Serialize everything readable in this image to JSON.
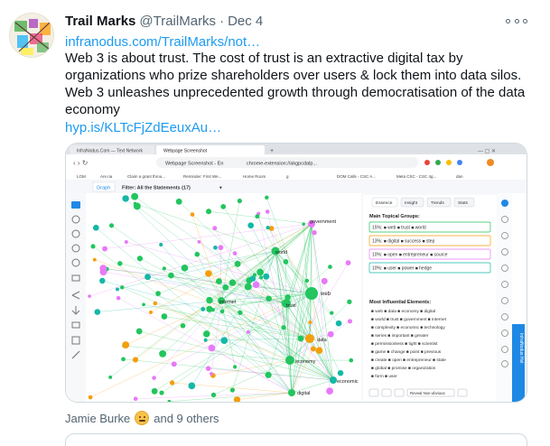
{
  "tweet": {
    "author_name": "Trail Marks",
    "handle": "@TrailMarks",
    "separator": "·",
    "date": "Dec 4",
    "link1": "infranodus.com/TrailMarks/not…",
    "text": "Web 3 is about trust. The cost of trust is an extractive digital tax by organizations who prize shareholders over users & lock them into data silos. Web 3 unleashes unprecedented growth through democratisation  of the data economy",
    "link2": "hyp.is/KLTcFjZdEeuxAu…",
    "likers_name": "Jamie Burke",
    "likers_rest": "and 9 others",
    "icons": {
      "more": "more-icon",
      "avatar": "avatar-image",
      "liker_emoji": "thinking-emoji-icon"
    },
    "colors": {
      "link": "#1d9bf0",
      "secondary": "#536471"
    }
  },
  "screenshot": {
    "tabs": [
      "InfraNodus.Com — Text Network",
      "Webpage Screenshot"
    ],
    "new_tab": "+",
    "address": "Webpage Screenshot - En",
    "address_url": "chrome-extension://akgpcdalp...",
    "bookmarks": [
      "LOM",
      "Are.na",
      "Claim a grant throu...",
      "Reminder: First We...",
      "Home Room",
      "g",
      "DOM Calls - CSC A...",
      "Meta CSC - CSC 4g...",
      "dan"
    ],
    "app_tab": "Graph",
    "filter_label": "Filter: All the Statements (17)",
    "filter_caret": "▾",
    "panel_tabs": [
      "Essence",
      "Insight",
      "Trends",
      "Stats"
    ],
    "main_groups_title": "Main Topical Groups:",
    "groups": [
      {
        "pct": "15%:",
        "terms": [
          "web",
          "trust",
          "world"
        ]
      },
      {
        "pct": "13%:",
        "terms": [
          "digital",
          "success",
          "step"
        ]
      },
      {
        "pct": "10%:",
        "terms": [
          "open",
          "entrepreneur",
          "source"
        ]
      },
      {
        "pct": "10%:",
        "terms": [
          "user",
          "power",
          "hedge"
        ]
      }
    ],
    "influential_title": "Most Influential Elements:",
    "influential_lines": [
      [
        "web",
        "data",
        "economy",
        "digital"
      ],
      [
        "world",
        "trust",
        "government",
        "internet"
      ],
      [
        "complexity",
        "economic",
        "technology"
      ],
      [
        "series",
        "important",
        "greater"
      ],
      [
        "permissionless",
        "tight",
        "scientist"
      ],
      [
        "game",
        "change",
        "point",
        "previous"
      ],
      [
        "create",
        "open",
        "entrepreneur",
        "state"
      ],
      [
        "global",
        "promise",
        "organization"
      ],
      [
        "form",
        "user"
      ]
    ],
    "reveal_button": "Reveal Non-obvious",
    "side_tab": "InfraNodus Hel",
    "node_labels": [
      "government",
      "world",
      "internet",
      "trust",
      "web",
      "data",
      "economy",
      "economic",
      "digital"
    ],
    "colors": {
      "green": "#22c55e",
      "pink": "#e879f9",
      "orange": "#f59e0b",
      "teal": "#14b8a6",
      "app_blue": "#1e88e5"
    }
  }
}
